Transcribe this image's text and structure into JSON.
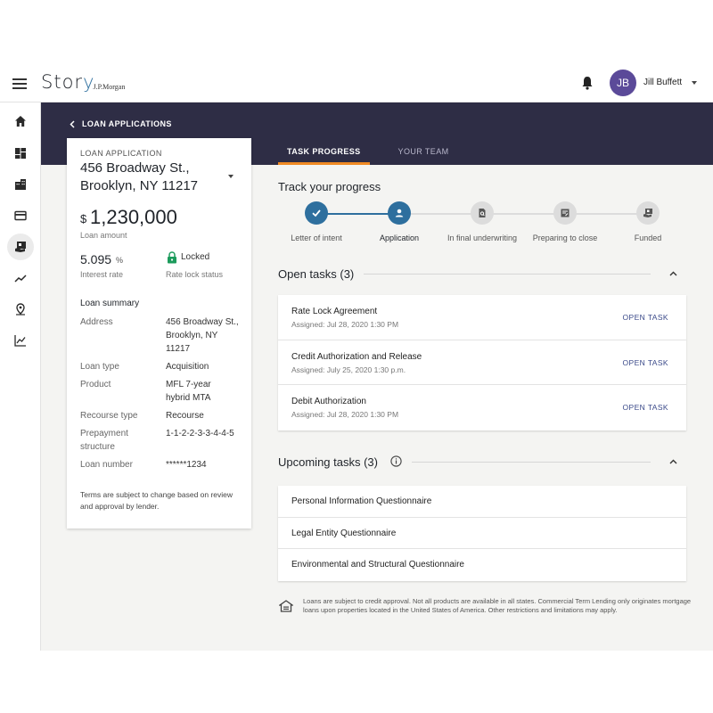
{
  "header": {
    "brand_main": "Stor",
    "brand_y": "y",
    "brand_sub": "J.P.Morgan",
    "user_initials": "JB",
    "user_name": "Jill Buffett"
  },
  "sidebar": {
    "items": [
      {
        "icon": "home-icon"
      },
      {
        "icon": "dashboard-icon"
      },
      {
        "icon": "building-icon"
      },
      {
        "icon": "card-icon"
      },
      {
        "icon": "loan-icon",
        "active": true
      },
      {
        "icon": "trend-icon"
      },
      {
        "icon": "map-pin-icon"
      },
      {
        "icon": "chart-icon"
      }
    ]
  },
  "breadcrumb": {
    "label": "LOAN APPLICATIONS"
  },
  "tabs": [
    {
      "label": "TASK PROGRESS",
      "active": true
    },
    {
      "label": "YOUR TEAM",
      "active": false
    }
  ],
  "loan": {
    "eyebrow": "LOAN APPLICATION",
    "address_line1": "456 Broadway St.,",
    "address_line2": "Brooklyn, NY 11217",
    "currency": "$",
    "amount": "1,230,000",
    "amount_label": "Loan amount",
    "rate": "5.095",
    "rate_pct": "%",
    "rate_label": "Interest rate",
    "lock_status": "Locked",
    "lock_label": "Rate lock status",
    "summary_title": "Loan summary",
    "summary": [
      {
        "label": "Address",
        "value": "456 Broadway St., Brooklyn, NY 11217"
      },
      {
        "label": "Loan type",
        "value": "Acquisition"
      },
      {
        "label": "Product",
        "value": "MFL 7-year hybrid MTA"
      },
      {
        "label": "Recourse type",
        "value": "Recourse"
      },
      {
        "label": "Prepayment structure",
        "value": "1-1-2-2-3-3-4-4-5"
      },
      {
        "label": "Loan number",
        "value": "******1234"
      }
    ],
    "terms": "Terms are subject to change based on review and approval by lender."
  },
  "progress": {
    "title": "Track your progress",
    "steps": [
      {
        "label": "Letter of intent",
        "state": "done",
        "icon": "check-icon"
      },
      {
        "label": "Application",
        "state": "current",
        "icon": "person-icon"
      },
      {
        "label": "In final underwriting",
        "state": "upcoming",
        "icon": "document-search-icon"
      },
      {
        "label": "Preparing to close",
        "state": "upcoming",
        "icon": "form-icon"
      },
      {
        "label": "Funded",
        "state": "upcoming",
        "icon": "funded-icon"
      }
    ],
    "colors": {
      "done": "#2e6f9e",
      "upcoming": "#dcdcdc",
      "line_done": "#2e6f9e",
      "line_upcoming": "#dcdcdc"
    }
  },
  "open_tasks": {
    "title": "Open tasks (3)",
    "items": [
      {
        "name": "Rate Lock Agreement",
        "meta": "Assigned: Jul 28, 2020 1:30 PM",
        "action": "OPEN TASK"
      },
      {
        "name": "Credit Authorization and Release",
        "meta": "Assigned: July 25, 2020 1:30 p.m.",
        "action": "OPEN TASK"
      },
      {
        "name": "Debit Authorization",
        "meta": "Assigned: Jul 28, 2020 1:30 PM",
        "action": "OPEN TASK"
      }
    ]
  },
  "upcoming_tasks": {
    "title": "Upcoming tasks (3)",
    "items": [
      {
        "name": "Personal Information Questionnaire"
      },
      {
        "name": "Legal Entity Questionnaire"
      },
      {
        "name": "Environmental and Structural Questionnaire"
      }
    ]
  },
  "disclaimer": "Loans are subject to credit approval. Not all products are available in all states. Commercial Term Lending only originates mortgage loans upon properties located in the United States of America. Other restrictions and limitations may apply."
}
